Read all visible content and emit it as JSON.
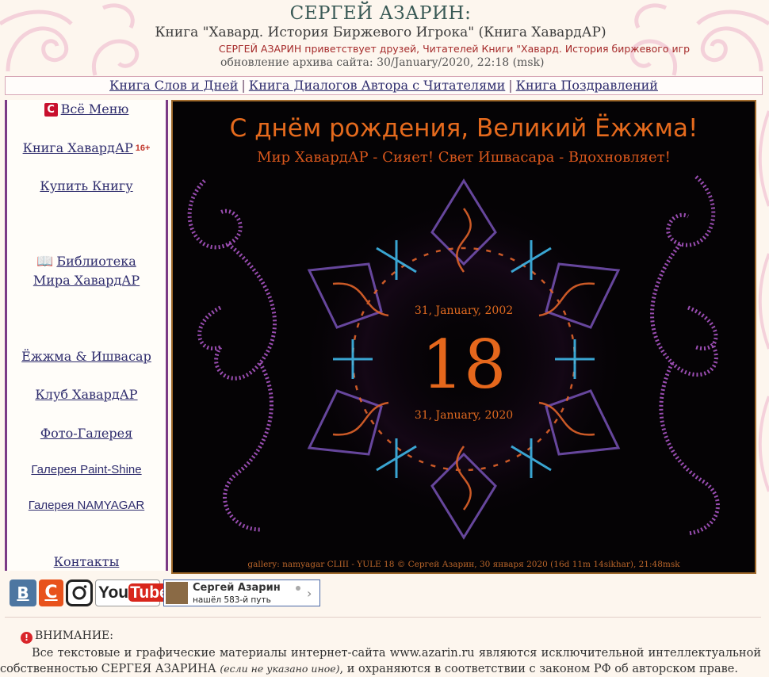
{
  "header": {
    "title": "СЕРГЕЙ АЗАРИН:",
    "subtitle": "Книга \"Хавард. История Биржевого Игрока\" (Книга ХавардАР)",
    "marquee": "СЕРГЕЙ АЗАРИН приветствует друзей, Читателей Книги \"Хавард. История биржевого игр",
    "update": "обновление архива сайта: 30/January/2020, 22:18 (msk)"
  },
  "topnav": {
    "link1": "Книга Слов и Дней",
    "link2": "Книга Диалогов Автора с Читателями",
    "link3": "Книга Поздравлений",
    "sep": "|"
  },
  "sidebar": {
    "menu_icon": "С",
    "menu": "Всё Меню",
    "book": "Книга ХавардАР",
    "book_badge": "16+",
    "buy": "Купить Книгу",
    "library_icon": "📖",
    "library_line1": "Библиотека",
    "library_line2": "Мира ХавардАР",
    "ezhma": "Ёжжма & Ишвасар",
    "club": "Клуб ХавардАР",
    "photo": "Фото-Галерея",
    "paint": "Галерея Paint-Shine",
    "namyagar": "Галерея NAMYAGAR",
    "contacts": "Контакты"
  },
  "banner": {
    "title": "С днём рождения, Великий Ёжжма!",
    "subtitle": "Мир ХавардАР - Сияет! Свет Ишвасара - Вдохновляет!",
    "date_top": "31, January, 2002",
    "number": "18",
    "date_bottom": "31, January, 2020",
    "caption": "gallery: namyagar CLIII - YULE 18 © Сергей Азарин, 30 января 2020 (16d 11m 14sikhar), 21:48msk"
  },
  "social": {
    "vk": "В",
    "c": "С",
    "yt_you": "You",
    "yt_tube": "Tube",
    "profile_name": "Сергей Азарин",
    "profile_status": "нашёл 583-й путь",
    "profile_chevron": "›"
  },
  "warning": {
    "icon": "!",
    "head": "ВНИМАНИЕ:",
    "body_start": "Все текстовые и графические материалы интернет-сайта www.azarin.ru являются исключительной интеллектуальной собственностью СЕРГЕЯ АЗАРИНА",
    "body_note": "(если не указано иное)",
    "body_end": ", и охраняются в соответствии с законом РФ об авторском праве."
  },
  "colors": {
    "background": "#fdf6ee",
    "link": "#2e2c6d",
    "sidebar_border": "#7b3b86",
    "banner_accent": "#e5671c"
  }
}
